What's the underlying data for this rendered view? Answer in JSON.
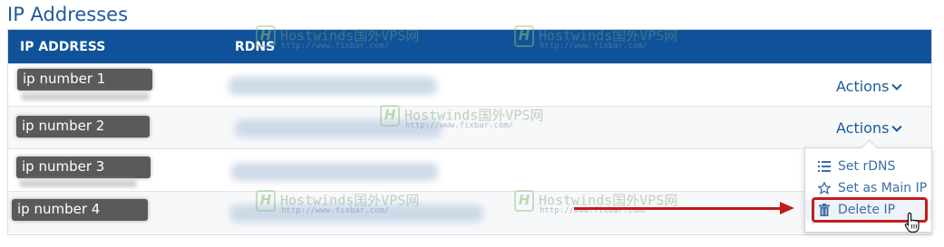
{
  "section": {
    "title": "IP Addresses"
  },
  "table": {
    "headers": {
      "ip": "IP ADDRESS",
      "rdns": "RDNS"
    },
    "rows": [
      {
        "ip": "ip number 1",
        "actions": "Actions"
      },
      {
        "ip": "ip number 2",
        "actions": "Actions"
      },
      {
        "ip": "ip number 3"
      },
      {
        "ip": "ip number 4"
      }
    ]
  },
  "dropdown": {
    "items": [
      {
        "label": "Set rDNS",
        "icon": "list-icon"
      },
      {
        "label": "Set as Main IP",
        "icon": "star-icon"
      },
      {
        "label": "Delete IP",
        "icon": "trash-icon"
      }
    ]
  },
  "watermark": {
    "brand": "Hostwinds国外VPS网",
    "url": "http://www.fixbar.com/"
  },
  "colors": {
    "header_bg": "#10529a",
    "link": "#1e5a9a",
    "annotation": "#c21b1b"
  }
}
